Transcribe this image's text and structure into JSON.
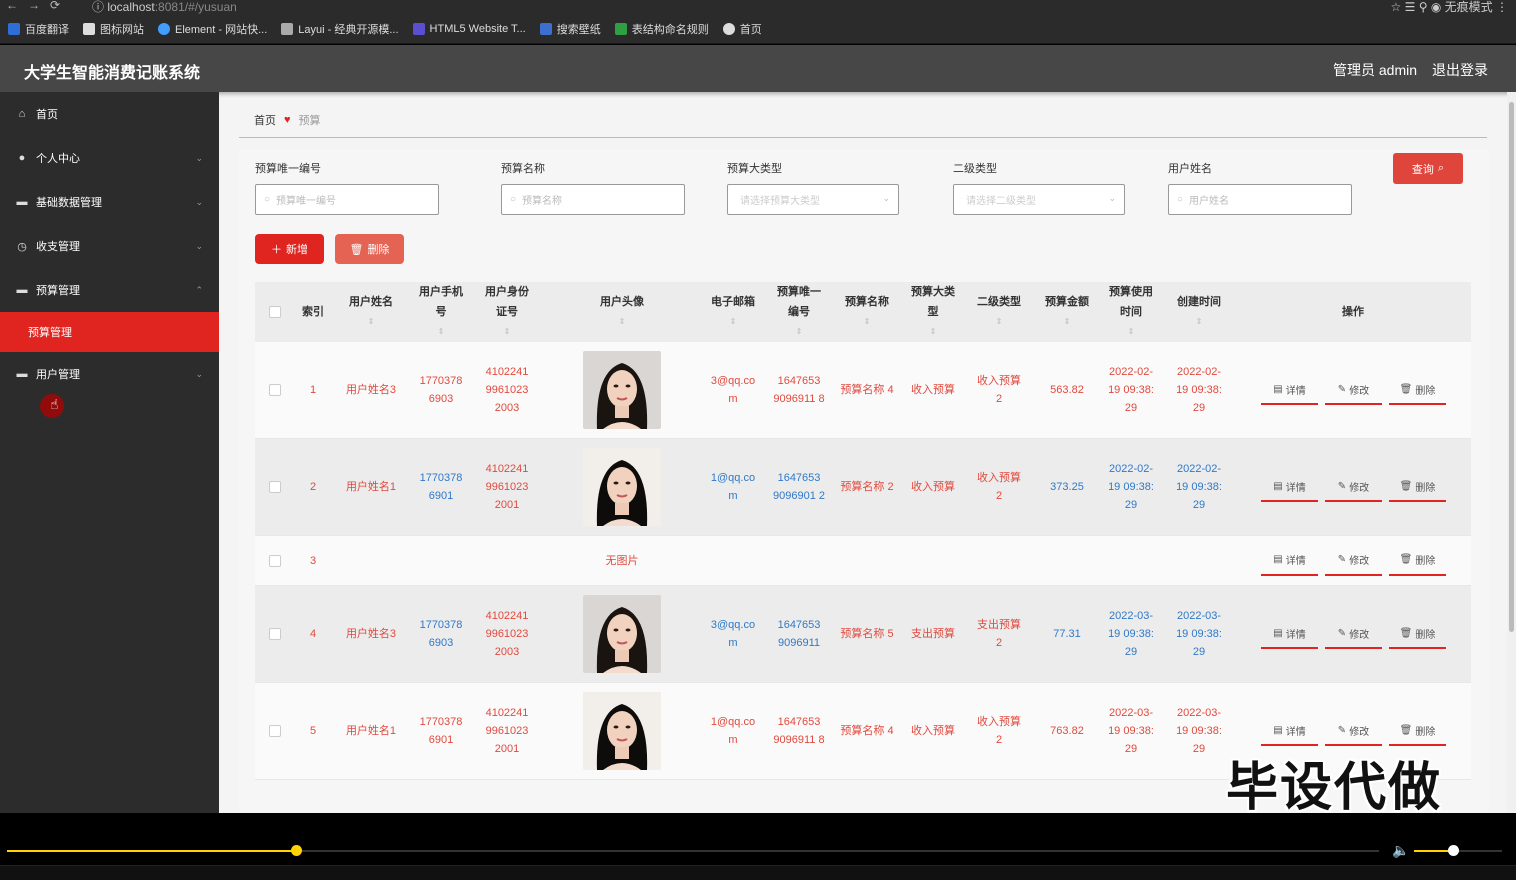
{
  "browser": {
    "url": "localhost",
    "url_rest": ":8081/#/yusuan",
    "profile": "无痕模式",
    "bookmarks": [
      "百度翻译",
      "图标网站",
      "Element - 网站快...",
      "Layui - 经典开源模...",
      "HTML5 Website T...",
      "搜索壁纸",
      "表结构命名规则",
      "首页"
    ]
  },
  "header": {
    "title": "大学生智能消费记账系统",
    "admin": "管理员 admin",
    "logout": "退出登录"
  },
  "sidebar": {
    "items": [
      {
        "label": "首页",
        "icon": "home-icon",
        "glyph": "⌂",
        "chev": ""
      },
      {
        "label": "个人中心",
        "icon": "user-icon",
        "glyph": "●",
        "chev": "⌄"
      },
      {
        "label": "基础数据管理",
        "icon": "database-icon",
        "glyph": "▬",
        "chev": "⌄"
      },
      {
        "label": "收支管理",
        "icon": "clock-icon",
        "glyph": "◷",
        "chev": "⌄"
      },
      {
        "label": "预算管理",
        "icon": "budget-icon",
        "glyph": "▬",
        "chev": "⌃"
      },
      {
        "label": "用户管理",
        "icon": "users-icon",
        "glyph": "▬",
        "chev": "⌄"
      }
    ],
    "submenu_active": "预算管理"
  },
  "breadcrumb": {
    "home": "首页",
    "current": "预算"
  },
  "filters": {
    "f1_label": "预算唯一编号",
    "f1_placeholder": "预算唯一编号",
    "f2_label": "预算名称",
    "f2_placeholder": "预算名称",
    "f3_label": "预算大类型",
    "f3_placeholder": "请选择预算大类型",
    "f4_label": "二级类型",
    "f4_placeholder": "请选择二级类型",
    "f5_label": "用户姓名",
    "f5_placeholder": "用户姓名",
    "search": "查询"
  },
  "actions": {
    "add": "新增",
    "delete": "删除"
  },
  "table": {
    "headers": {
      "index": "索引",
      "name": "用户姓名",
      "phone": "用户手机号",
      "idcard": "用户身份证号",
      "avatar": "用户头像",
      "email": "电子邮箱",
      "uid": "预算唯一编号",
      "bname": "预算名称",
      "btype": "预算大类型",
      "stype": "二级类型",
      "amount": "预算金额",
      "usetime": "预算使用时间",
      "ctime": "创建时间",
      "ops": "操作"
    },
    "rows": [
      {
        "index": "1",
        "name": "用户姓名3",
        "phone": "1770378 6903",
        "idcard": "4102241 9961023 2003",
        "avatar": "face-a",
        "email": "3@qq.co m",
        "uid": "1647653 9096911 8",
        "bname": "预算名称 4",
        "btype": "收入预算",
        "stype": "收入预算 2",
        "amount": "563.82",
        "usetime": "2022-02- 19 09:38: 29",
        "ctime": "2022-02- 19 09:38: 29"
      },
      {
        "index": "2",
        "name": "用户姓名1",
        "phone": "1770378 6901",
        "idcard": "4102241 9961023 2001",
        "avatar": "face-b",
        "email": "1@qq.co m",
        "uid": "1647653 9096901 2",
        "bname": "预算名称 2",
        "btype": "收入预算",
        "stype": "收入预算 2",
        "amount": "373.25",
        "usetime": "2022-02- 19 09:38: 29",
        "ctime": "2022-02- 19 09:38: 29"
      },
      {
        "index": "3",
        "name": "",
        "phone": "",
        "idcard": "",
        "avatar": "none",
        "no_image": "无图片",
        "email": "",
        "uid": "",
        "bname": "",
        "btype": "",
        "stype": "",
        "amount": "",
        "usetime": "",
        "ctime": ""
      },
      {
        "index": "4",
        "name": "用户姓名3",
        "phone": "1770378 6903",
        "idcard": "4102241 9961023 2003",
        "avatar": "face-a",
        "email": "3@qq.co m",
        "uid": "1647653 9096911",
        "bname": "预算名称 5",
        "btype": "支出预算",
        "stype": "支出预算 2",
        "amount": "77.31",
        "usetime": "2022-03- 19 09:38: 29",
        "ctime": "2022-03- 19 09:38: 29"
      },
      {
        "index": "5",
        "name": "用户姓名1",
        "phone": "1770378 6901",
        "idcard": "4102241 9961023 2001",
        "avatar": "face-b",
        "email": "1@qq.co m",
        "uid": "1647653 9096911 8",
        "bname": "预算名称 4",
        "btype": "收入预算",
        "stype": "收入预算 2",
        "amount": "763.82",
        "usetime": "2022-03- 19 09:38: 29",
        "ctime": "2022-03- 19 09:38: 29"
      }
    ],
    "op_detail": "详情",
    "op_edit": "修改",
    "op_delete": "删除"
  },
  "watermark": "毕设代做",
  "player": {
    "progress": 0.211,
    "volume": 0.44
  }
}
